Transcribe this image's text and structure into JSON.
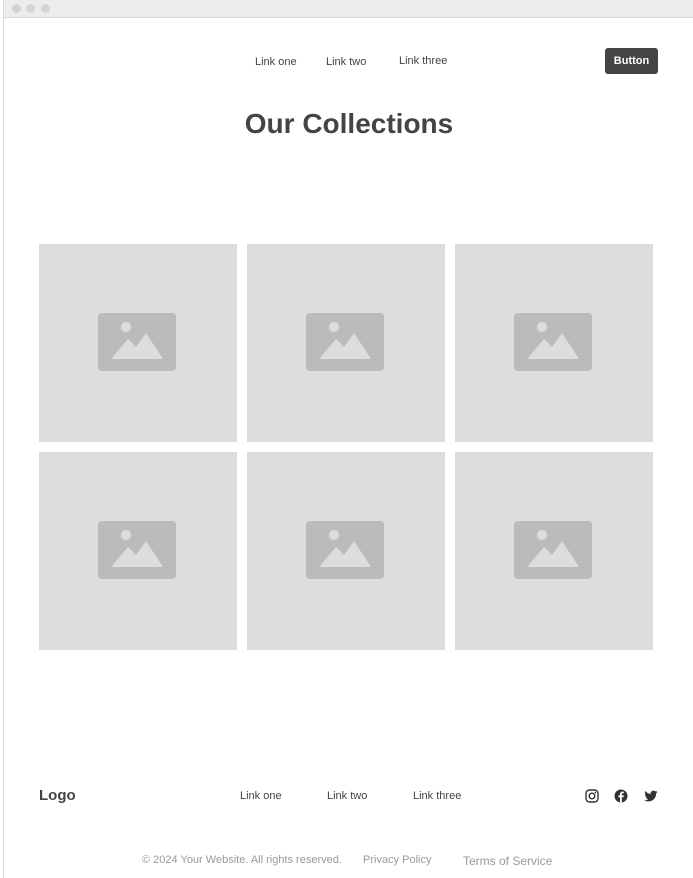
{
  "nav": {
    "links": [
      "Link one",
      "Link two",
      "Link three"
    ],
    "button_label": "Button"
  },
  "main": {
    "title": "Our Collections",
    "collection_items": [
      {
        "icon": "image-placeholder-icon"
      },
      {
        "icon": "image-placeholder-icon"
      },
      {
        "icon": "image-placeholder-icon"
      },
      {
        "icon": "image-placeholder-icon"
      },
      {
        "icon": "image-placeholder-icon"
      },
      {
        "icon": "image-placeholder-icon"
      }
    ]
  },
  "footer": {
    "logo": "Logo",
    "links": [
      "Link one",
      "Link two",
      "Link three"
    ],
    "social_icons": [
      "instagram-icon",
      "facebook-icon",
      "twitter-icon"
    ],
    "copyright": "© 2024 Your Website. All rights reserved.",
    "privacy_label": "Privacy Policy",
    "terms_label": "Terms of Service"
  },
  "colors": {
    "text_dark": "#444444",
    "button_bg": "#444444",
    "placeholder_bg": "#dddddd",
    "placeholder_icon": "#bbbbbb",
    "muted_text": "#9a9a9a"
  }
}
